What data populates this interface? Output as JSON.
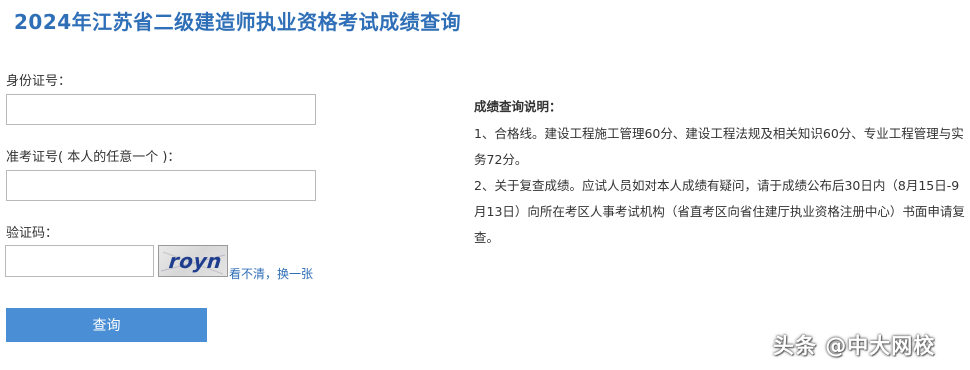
{
  "header": {
    "title": "2024年江苏省二级建造师执业资格考试成绩查询"
  },
  "form": {
    "id_label": "身份证号：",
    "id_value": "",
    "exam_no_label": "准考证号( 本人的任意一个 )：",
    "exam_no_value": "",
    "captcha_label": "验证码：",
    "captcha_value": "",
    "captcha_image_text": "royn",
    "refresh_link": "看不清，换一张",
    "submit_label": "查询"
  },
  "notes": {
    "title": "成绩查询说明：",
    "items": [
      "1、合格线。建设工程施工管理60分、建设工程法规及相关知识60分、专业工程管理与实务72分。",
      "2、关于复查成绩。应试人员如对本人成绩有疑问，请于成绩公布后30日内（8月15日-9月13日）向所在考区人事考试机构（省直考区向省住建厅执业资格注册中心）书面申请复查。"
    ]
  },
  "watermark": {
    "text": "头条 @中大网校"
  },
  "colors": {
    "title": "#2f6fb7",
    "button": "#4a8fd6",
    "link": "#2f6fb7"
  }
}
